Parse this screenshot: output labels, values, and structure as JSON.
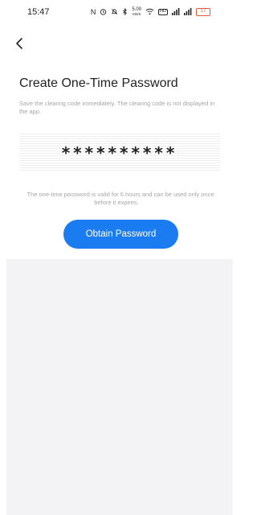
{
  "status_bar": {
    "time": "15:47",
    "icons": [
      "nfc-icon",
      "alarm-icon",
      "silent-icon",
      "bluetooth-icon",
      "network-speed-icon",
      "wifi-icon",
      "hd-icon",
      "signal-icon",
      "signal-icon",
      "battery-icon"
    ],
    "speed": "5.00",
    "speed_unit": "KB/S",
    "hd": "HD",
    "battery_level": "17"
  },
  "header": {
    "back_icon": "chevron-left-icon"
  },
  "main": {
    "title": "Create One-Time Password",
    "subtitle": "Save the clearing code immediately. The clearing code is not displayed in the app.",
    "password_masked": "**********",
    "note_line1": "The one-time password is valid for 6 hours and can be used only once",
    "note_line2": "before it expires.",
    "obtain_button_label": "Obtain Password"
  },
  "colors": {
    "accent": "#1b7cf2",
    "hint_text": "#a6a6a6",
    "bottom_panel": "#f3f3f5"
  }
}
